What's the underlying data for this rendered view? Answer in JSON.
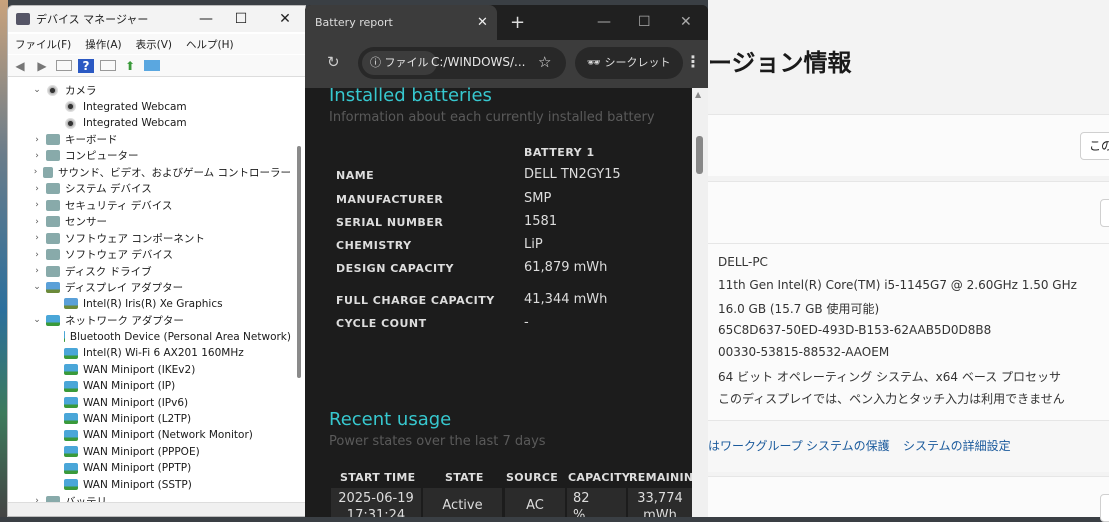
{
  "device_manager": {
    "title": "デバイス マネージャー",
    "menu": [
      "ファイル(F)",
      "操作(A)",
      "表示(V)",
      "ヘルプ(H)"
    ],
    "tree": [
      {
        "label": "カメラ",
        "level": 0,
        "expanded": true,
        "icon": "camera"
      },
      {
        "label": "Integrated Webcam",
        "level": 1,
        "icon": "camera"
      },
      {
        "label": "Integrated Webcam",
        "level": 1,
        "icon": "camera"
      },
      {
        "label": "キーボード",
        "level": 0,
        "icon": "keyboard"
      },
      {
        "label": "コンピューター",
        "level": 0,
        "icon": "computer"
      },
      {
        "label": "サウンド、ビデオ、およびゲーム コントローラー",
        "level": 0,
        "icon": "speaker"
      },
      {
        "label": "システム デバイス",
        "level": 0,
        "icon": "system"
      },
      {
        "label": "セキュリティ デバイス",
        "level": 0,
        "icon": "security"
      },
      {
        "label": "センサー",
        "level": 0,
        "icon": "sensor"
      },
      {
        "label": "ソフトウェア コンポーネント",
        "level": 0,
        "icon": "software"
      },
      {
        "label": "ソフトウェア デバイス",
        "level": 0,
        "icon": "software"
      },
      {
        "label": "ディスク ドライブ",
        "level": 0,
        "icon": "disk"
      },
      {
        "label": "ディスプレイ アダプター",
        "level": 0,
        "expanded": true,
        "icon": "display"
      },
      {
        "label": "Intel(R) Iris(R) Xe Graphics",
        "level": 1,
        "icon": "display"
      },
      {
        "label": "ネットワーク アダプター",
        "level": 0,
        "expanded": true,
        "icon": "network"
      },
      {
        "label": "Bluetooth Device (Personal Area Network)",
        "level": 1,
        "icon": "network"
      },
      {
        "label": "Intel(R) Wi-Fi 6 AX201 160MHz",
        "level": 1,
        "icon": "network"
      },
      {
        "label": "WAN Miniport (IKEv2)",
        "level": 1,
        "icon": "network"
      },
      {
        "label": "WAN Miniport (IP)",
        "level": 1,
        "icon": "network"
      },
      {
        "label": "WAN Miniport (IPv6)",
        "level": 1,
        "icon": "network"
      },
      {
        "label": "WAN Miniport (L2TP)",
        "level": 1,
        "icon": "network"
      },
      {
        "label": "WAN Miniport (Network Monitor)",
        "level": 1,
        "icon": "network"
      },
      {
        "label": "WAN Miniport (PPPOE)",
        "level": 1,
        "icon": "network"
      },
      {
        "label": "WAN Miniport (PPTP)",
        "level": 1,
        "icon": "network"
      },
      {
        "label": "WAN Miniport (SSTP)",
        "level": 1,
        "icon": "network"
      },
      {
        "label": "バッテリ",
        "level": 0,
        "icon": "battery"
      }
    ]
  },
  "browser": {
    "tab_title": "Battery report",
    "chip": "ファイル",
    "url": "C:/WINDOWS/...",
    "incognito": "シークレット",
    "installed": {
      "title": "Installed batteries",
      "subtitle": "Information about each currently installed battery",
      "column": "BATTERY 1",
      "rows": [
        {
          "label": "NAME",
          "value": "DELL TN2GY15"
        },
        {
          "label": "MANUFACTURER",
          "value": "SMP"
        },
        {
          "label": "SERIAL NUMBER",
          "value": "1581"
        },
        {
          "label": "CHEMISTRY",
          "value": "LiP"
        },
        {
          "label": "DESIGN CAPACITY",
          "value": "61,879 mWh"
        },
        {
          "label": "FULL CHARGE CAPACITY",
          "value": "41,344 mWh"
        },
        {
          "label": "CYCLE COUNT",
          "value": "-"
        }
      ]
    },
    "recent": {
      "title": "Recent usage",
      "subtitle": "Power states over the last 7 days",
      "headers": [
        "START TIME",
        "STATE",
        "SOURCE",
        "CAPACITY",
        "REMAININ"
      ],
      "row": [
        "2025-06-19 17:31:24",
        "Active",
        "AC",
        "82 %",
        "33,774 mWh"
      ]
    }
  },
  "settings": {
    "title": "ージョン情報",
    "button1": "この",
    "specs": [
      "DELL-PC",
      "11th Gen Intel(R) Core(TM) i5-1145G7 @ 2.60GHz   1.50 GHz",
      "16.0 GB (15.7 GB 使用可能)",
      "65C8D637-50ED-493D-B153-62AAB5D0D8B8",
      "00330-53815-88532-AAOEM",
      "64 ビット オペレーティング システム、x64 ベース プロセッサ",
      "このディスプレイでは、ペン入力とタッチ入力は利用できません"
    ],
    "links": [
      "はワークグループ",
      "システムの保護",
      "システムの詳細設定"
    ]
  }
}
